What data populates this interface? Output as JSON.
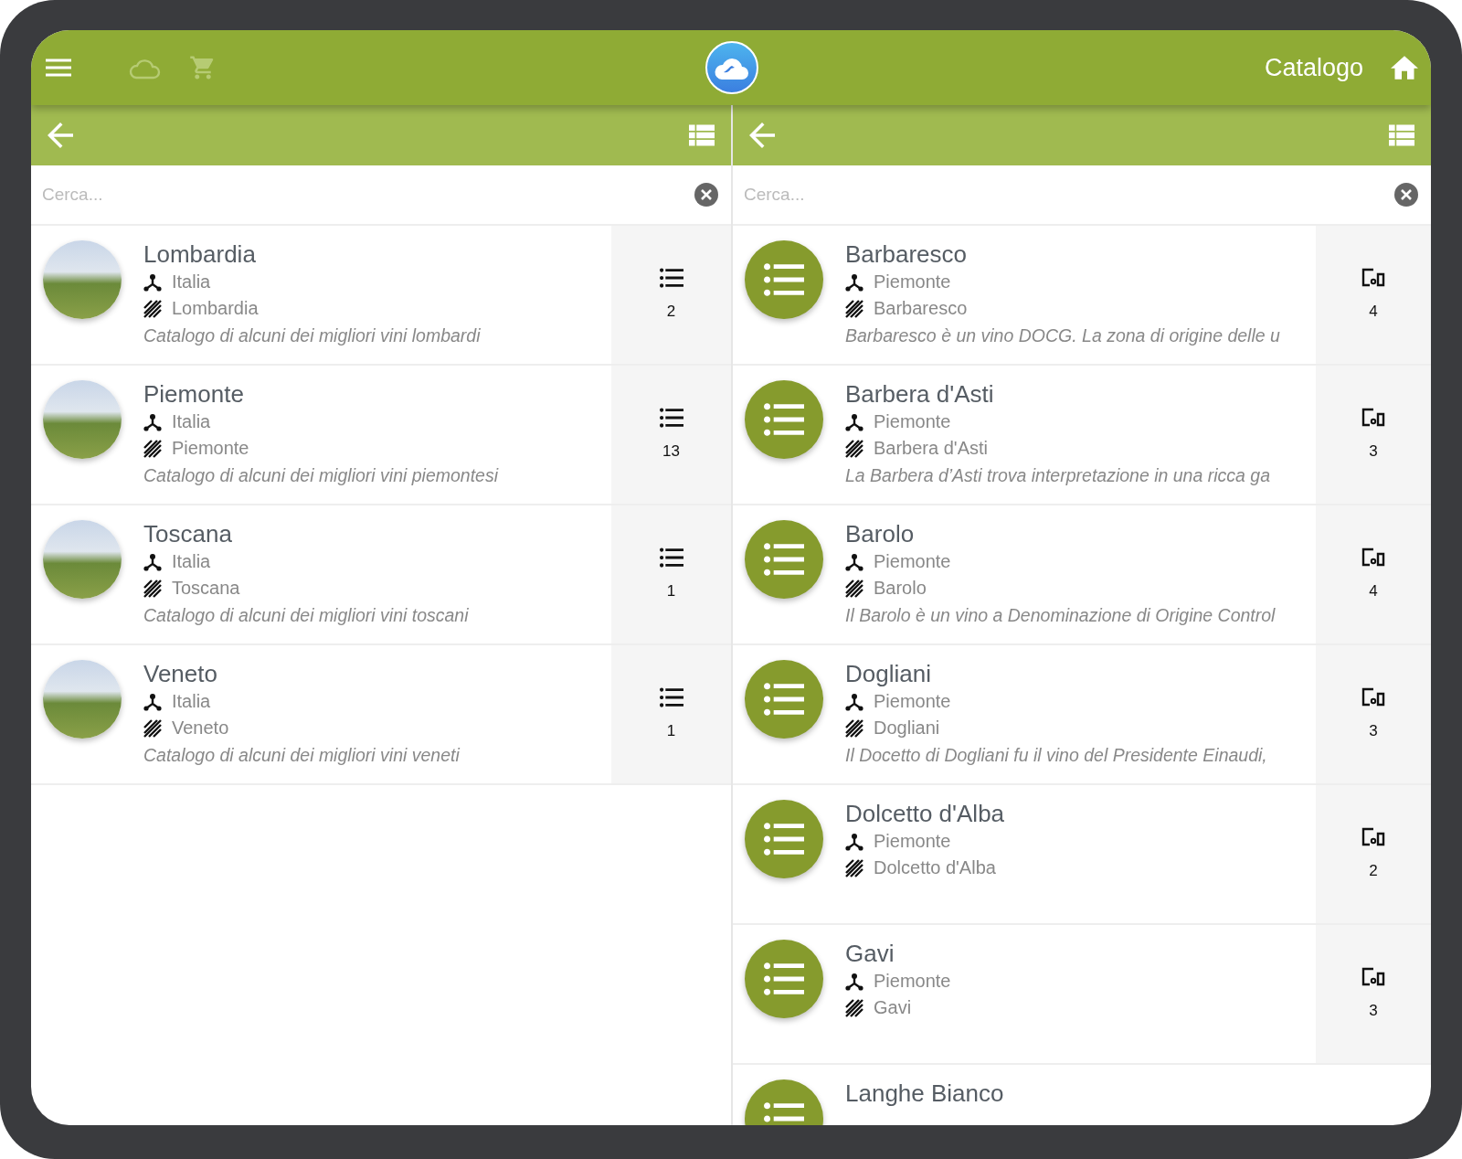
{
  "header": {
    "title": "Catalogo"
  },
  "panes": [
    {
      "kind": "list",
      "search": {
        "placeholder": "Cerca..."
      },
      "items": [
        {
          "kind": "photo",
          "title": "Lombardia",
          "country": "Italia",
          "region": "Lombardia",
          "description": "Catalogo di alcuni dei migliori vini lombardi",
          "count": "2"
        },
        {
          "kind": "photo",
          "title": "Piemonte",
          "country": "Italia",
          "region": "Piemonte",
          "description": "Catalogo di alcuni dei migliori vini piemontesi",
          "count": "13"
        },
        {
          "kind": "photo",
          "title": "Toscana",
          "country": "Italia",
          "region": "Toscana",
          "description": "Catalogo di alcuni dei migliori vini toscani",
          "count": "1"
        },
        {
          "kind": "photo",
          "title": "Veneto",
          "country": "Italia",
          "region": "Veneto",
          "description": "Catalogo di alcuni dei migliori vini veneti",
          "count": "1"
        }
      ]
    },
    {
      "kind": "devices",
      "search": {
        "placeholder": "Cerca..."
      },
      "items": [
        {
          "kind": "list",
          "title": "Barbaresco",
          "country": "Piemonte",
          "region": "Barbaresco",
          "description": "Barbaresco è un vino DOCG. La zona di origine delle u",
          "count": "4"
        },
        {
          "kind": "list",
          "title": "Barbera d'Asti",
          "country": "Piemonte",
          "region": "Barbera d'Asti",
          "description": "La Barbera d’Asti trova interpretazione in una ricca ga",
          "count": "3"
        },
        {
          "kind": "list",
          "title": "Barolo",
          "country": "Piemonte",
          "region": "Barolo",
          "description": "Il Barolo è un vino a Denominazione di Origine Control",
          "count": "4"
        },
        {
          "kind": "list",
          "title": "Dogliani",
          "country": "Piemonte",
          "region": "Dogliani",
          "description": "Il Docetto di Dogliani fu il vino del Presidente Einaudi,",
          "count": "3"
        },
        {
          "kind": "list",
          "title": "Dolcetto d'Alba",
          "country": "Piemonte",
          "region": "Dolcetto d'Alba",
          "count": "2"
        },
        {
          "kind": "list",
          "title": "Gavi",
          "country": "Piemonte",
          "region": "Gavi",
          "count": "3"
        },
        {
          "kind": "list",
          "title": "Langhe Bianco"
        }
      ]
    }
  ]
}
